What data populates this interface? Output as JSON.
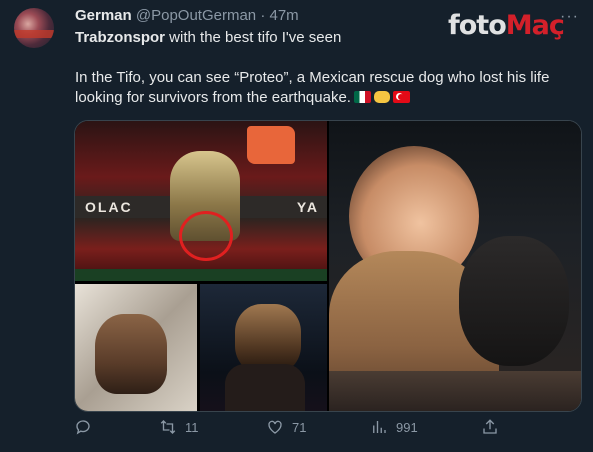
{
  "tweet": {
    "author_name": "German",
    "handle": "@PopOutGerman",
    "separator": "·",
    "time": "47m",
    "line1_bold": "Trabzonspor",
    "line1_rest": " with the best tifo I've seen",
    "line2": "In the Tifo, you can see “Proteo”, a Mexican rescue dog who lost his life looking for survivors from the earthquake.",
    "emoji": [
      "flag-mexico",
      "handshake",
      "flag-turkey"
    ]
  },
  "watermark": {
    "part1": "foto",
    "part2": "Maç"
  },
  "media": {
    "banner_left": "OLAC",
    "banner_right": "YA"
  },
  "actions": {
    "reply_count": "",
    "retweet_count": "11",
    "like_count": "71",
    "view_count": "991"
  },
  "colors": {
    "background": "#15202b",
    "text": "#e7e9ea",
    "muted": "#8b98a5",
    "watermark_accent": "#e4202a"
  }
}
